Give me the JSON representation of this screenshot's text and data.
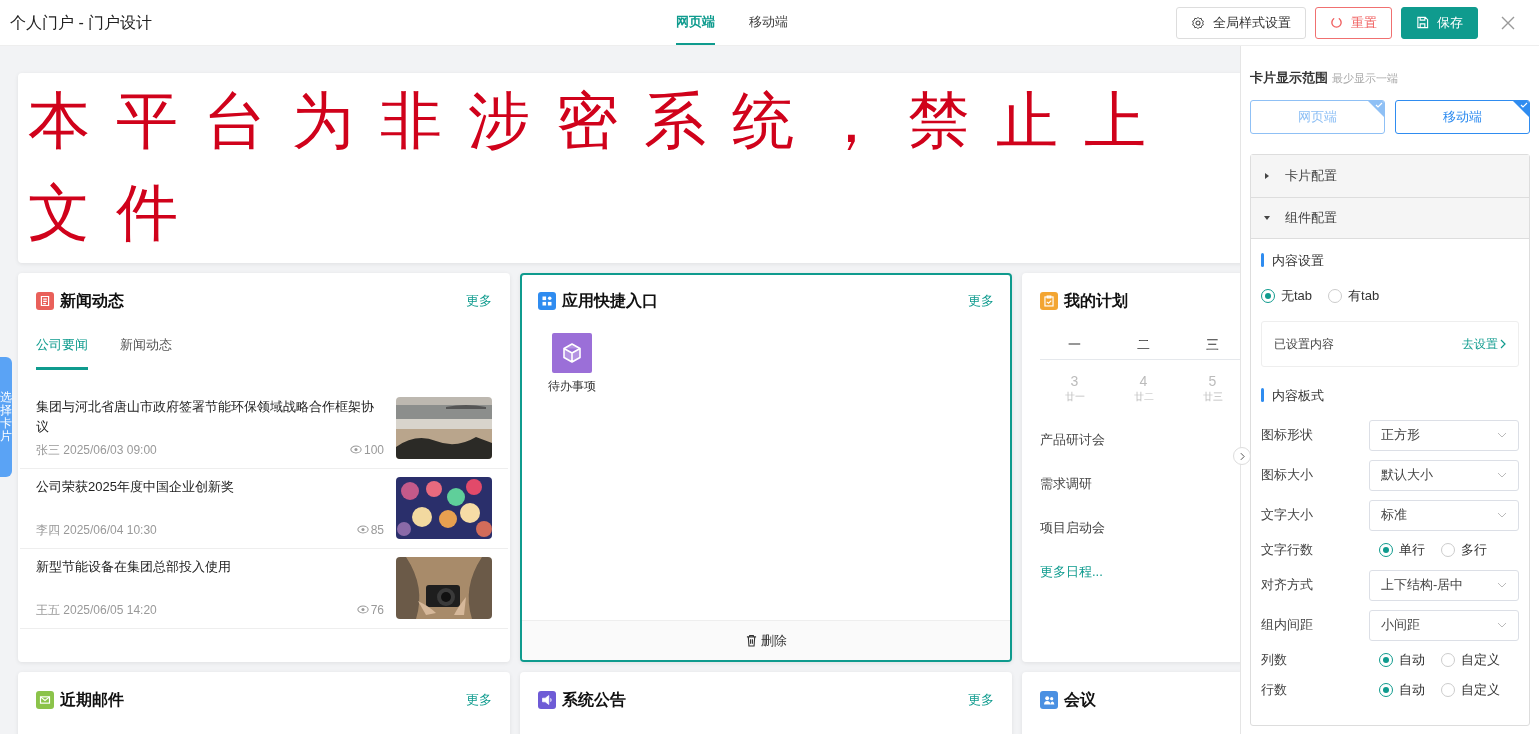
{
  "header": {
    "title": "个人门户 - 门户设计",
    "tabs": [
      {
        "label": "网页端",
        "selected": true
      },
      {
        "label": "移动端",
        "selected": false
      }
    ],
    "buttons": [
      {
        "kind": "settings",
        "label": "全局样式设置"
      },
      {
        "kind": "reset",
        "label": "重置"
      },
      {
        "kind": "save",
        "label": "保存"
      }
    ]
  },
  "side_tab": {
    "label": "选择卡片"
  },
  "banner": {
    "lines": [
      "本平台为非涉密系统，禁止上",
      "文件"
    ]
  },
  "cards": [
    {
      "kind": "news",
      "title": "新闻动态",
      "color": "#e9605a",
      "more": "更多",
      "selected": false,
      "tabs": [
        {
          "label": "公司要闻",
          "selected": true
        },
        {
          "label": "新闻动态",
          "selected": false
        }
      ],
      "items": [
        {
          "title": "集团与河北省唐山市政府签署节能环保领域战略合作框架协议",
          "author": "张三",
          "time": "2025/06/03 09:00",
          "views": "100"
        },
        {
          "title": "公司荣获2025年度中国企业创新奖",
          "author": "李四",
          "time": "2025/06/04 10:30",
          "views": "85"
        },
        {
          "title": "新型节能设备在集团总部投入使用",
          "author": "王五",
          "time": "2025/06/05 14:20",
          "views": "76"
        }
      ]
    },
    {
      "kind": "apps",
      "title": "应用快捷入口",
      "color": "#2f8cf0",
      "more": "更多",
      "selected": true,
      "delete_label": "删除",
      "items": [
        {
          "label": "待办事项"
        }
      ]
    },
    {
      "kind": "plan",
      "title": "我的计划",
      "color": "#f3a531",
      "selected": false,
      "weekdays": [
        "一",
        "二",
        "三"
      ],
      "days": [
        {
          "date": "3",
          "lunar": "廿一"
        },
        {
          "date": "4",
          "lunar": "廿二"
        },
        {
          "date": "5",
          "lunar": "廿三"
        }
      ],
      "events": [
        "产品研讨会",
        "需求调研",
        "项目启动会"
      ],
      "more_link": "更多日程..."
    },
    {
      "kind": "mail",
      "title": "近期邮件",
      "color": "#8bc34a",
      "more": "更多",
      "selected": false
    },
    {
      "kind": "notice",
      "title": "系统公告",
      "color": "#6e5bd6",
      "more": "更多",
      "selected": false
    },
    {
      "kind": "meeting",
      "title": "会议",
      "color": "#4a90e2",
      "selected": false
    }
  ],
  "panel": {
    "display_range": {
      "title": "卡片显示范围",
      "hint": "最少显示一端",
      "options": [
        {
          "label": "网页端",
          "selected": true,
          "disabled": true
        },
        {
          "label": "移动端",
          "selected": true,
          "disabled": false
        }
      ]
    },
    "accordion": [
      {
        "title": "卡片配置",
        "expanded": false
      },
      {
        "title": "组件配置",
        "expanded": true,
        "content_settings": {
          "heading": "内容设置",
          "radios": [
            {
              "label": "无tab",
              "selected": true
            },
            {
              "label": "有tab",
              "selected": false
            }
          ],
          "set_row": {
            "label": "已设置内容",
            "link": "去设置"
          }
        },
        "layout": {
          "heading": "内容板式",
          "rows": [
            {
              "kind": "select",
              "label": "图标形状",
              "value": "正方形"
            },
            {
              "kind": "select",
              "label": "图标大小",
              "value": "默认大小"
            },
            {
              "kind": "select",
              "label": "文字大小",
              "value": "标准"
            },
            {
              "kind": "radio",
              "label": "文字行数",
              "options": [
                {
                  "label": "单行",
                  "selected": true
                },
                {
                  "label": "多行",
                  "selected": false
                }
              ]
            },
            {
              "kind": "select",
              "label": "对齐方式",
              "value": "上下结构-居中"
            },
            {
              "kind": "select",
              "label": "组内间距",
              "value": "小间距"
            },
            {
              "kind": "radio",
              "label": "列数",
              "options": [
                {
                  "label": "自动",
                  "selected": true
                },
                {
                  "label": "自定义",
                  "selected": false
                }
              ]
            },
            {
              "kind": "radio",
              "label": "行数",
              "options": [
                {
                  "label": "自动",
                  "selected": true
                },
                {
                  "label": "自定义",
                  "selected": false
                }
              ]
            }
          ]
        }
      }
    ]
  }
}
